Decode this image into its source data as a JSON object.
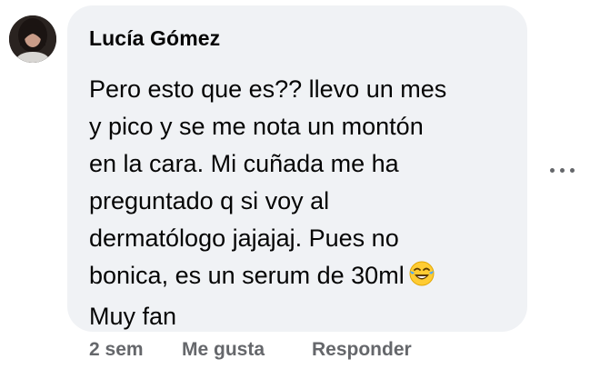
{
  "comment": {
    "author": "Lucía Gómez",
    "text": "Pero esto que es?? llevo un mes\ny pico y se me nota un montón\nen la cara. Mi cuñada me ha\npreguntado q si voy al\ndermatólogo jajajaj. Pues no\nbonica, es un serum de 30ml",
    "text_tail": "Muy fan",
    "emoji": "face-with-tears-of-joy"
  },
  "actions": {
    "time": "2 sem",
    "like": "Me gusta",
    "reply": "Responder"
  },
  "colors": {
    "bubble": "#f0f2f5",
    "text": "#050505",
    "secondary": "#65676b"
  }
}
